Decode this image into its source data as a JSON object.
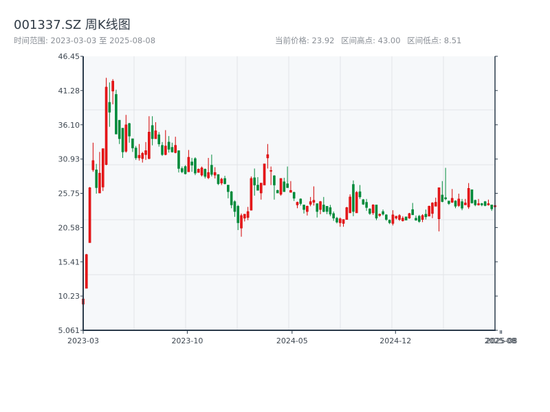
{
  "header": {
    "title": "001337.SZ 周K线图",
    "range_label": "时间范围: 2023-03-03 至 2025-08-08",
    "current_price": "当前价格: 23.92",
    "range_high": "区间高点: 43.00",
    "range_low": "区间低点: 8.51"
  },
  "colors": {
    "up": "#d40000",
    "down": "#008a3a",
    "plot_bg": "#f6f8fa",
    "axis": "#2a3a4a"
  },
  "chart_data": {
    "type": "candlestick",
    "title": "001337.SZ 周K线图",
    "xlabel": "",
    "ylabel": "",
    "ylim": [
      5.061,
      46.45
    ],
    "y_ticks": [
      "46.45",
      "41.28",
      "36.10",
      "30.93",
      "25.75",
      "20.58",
      "15.41",
      "10.23",
      "5.061"
    ],
    "x_ticks": [
      {
        "label": "2023-03",
        "index": 0
      },
      {
        "label": "2023-10",
        "index": 31.6
      },
      {
        "label": "2024-05",
        "index": 63.4
      },
      {
        "label": "2024-12",
        "index": 94.8
      },
      {
        "label": "2025-08",
        "index": 126.6
      },
      {
        "label": "2025-08",
        "index": 127
      }
    ],
    "grid": true,
    "ohlc": [
      [
        9.0,
        10.1,
        8.51,
        9.8
      ],
      [
        11.4,
        16.6,
        11.4,
        16.5
      ],
      [
        18.3,
        26.7,
        18.3,
        26.6
      ],
      [
        29.3,
        33.4,
        29.0,
        30.7
      ],
      [
        29.3,
        30.2,
        25.7,
        26.6
      ],
      [
        25.8,
        32.0,
        25.8,
        28.8
      ],
      [
        26.7,
        32.5,
        26.1,
        32.5
      ],
      [
        30.1,
        43.2,
        30.0,
        41.8
      ],
      [
        39.5,
        42.5,
        35.8,
        38.0
      ],
      [
        41.2,
        43.0,
        39.2,
        42.7
      ],
      [
        40.7,
        41.4,
        34.7,
        34.7
      ],
      [
        36.8,
        36.8,
        33.2,
        34.0
      ],
      [
        35.6,
        35.6,
        31.1,
        32.0
      ],
      [
        32.1,
        37.6,
        31.9,
        36.1
      ],
      [
        36.3,
        36.4,
        33.4,
        34.4
      ],
      [
        34.0,
        34.0,
        32.0,
        32.6
      ],
      [
        32.6,
        32.9,
        30.8,
        31.1
      ],
      [
        31.1,
        33.2,
        30.7,
        31.5
      ],
      [
        31.0,
        32.0,
        30.4,
        31.8
      ],
      [
        31.6,
        33.5,
        30.8,
        32.2
      ],
      [
        31.0,
        37.4,
        30.9,
        35.0
      ],
      [
        36.0,
        37.4,
        33.0,
        34.0
      ],
      [
        34.0,
        36.5,
        34.0,
        35.2
      ],
      [
        34.6,
        35.0,
        32.8,
        33.2
      ],
      [
        33.0,
        33.5,
        31.4,
        31.6
      ],
      [
        31.6,
        35.3,
        31.5,
        32.9
      ],
      [
        33.5,
        34.4,
        31.9,
        32.4
      ],
      [
        32.7,
        33.4,
        31.9,
        32.0
      ],
      [
        31.9,
        34.3,
        31.8,
        33.0
      ],
      [
        32.2,
        32.2,
        28.9,
        29.5
      ],
      [
        29.5,
        29.8,
        28.8,
        29.0
      ],
      [
        29.8,
        30.0,
        28.6,
        28.7
      ],
      [
        29.0,
        32.3,
        29.0,
        31.2
      ],
      [
        30.5,
        31.1,
        29.0,
        30.0
      ],
      [
        31.0,
        31.2,
        28.5,
        28.8
      ],
      [
        28.9,
        29.5,
        28.9,
        29.4
      ],
      [
        28.5,
        29.8,
        28.3,
        29.6
      ],
      [
        29.4,
        29.5,
        28.0,
        28.3
      ],
      [
        28.1,
        31.1,
        27.9,
        28.9
      ],
      [
        30.0,
        31.6,
        28.3,
        28.6
      ],
      [
        28.5,
        29.7,
        28.0,
        28.9
      ],
      [
        28.6,
        28.6,
        27.0,
        27.2
      ],
      [
        27.3,
        28.1,
        27.0,
        27.9
      ],
      [
        28.0,
        28.4,
        27.1,
        27.2
      ],
      [
        27.0,
        27.0,
        25.0,
        26.0
      ],
      [
        26.0,
        26.1,
        23.5,
        24.0
      ],
      [
        24.5,
        24.7,
        22.2,
        23.0
      ],
      [
        23.8,
        24.0,
        20.2,
        21.3
      ],
      [
        20.5,
        22.7,
        19.2,
        22.4
      ],
      [
        22.0,
        22.6,
        21.5,
        22.6
      ],
      [
        22.1,
        23.7,
        21.7,
        23.0
      ],
      [
        23.2,
        28.3,
        23.2,
        28.0
      ],
      [
        28.1,
        29.5,
        25.4,
        27.0
      ],
      [
        27.0,
        28.2,
        26.2,
        26.2
      ],
      [
        25.8,
        27.3,
        24.8,
        27.3
      ],
      [
        27.0,
        30.2,
        27.0,
        30.2
      ],
      [
        31.1,
        33.2,
        29.5,
        31.6
      ],
      [
        29.1,
        29.8,
        27.0,
        29.2
      ],
      [
        28.4,
        28.5,
        24.8,
        27.0
      ],
      [
        26.2,
        26.3,
        25.8,
        25.8
      ],
      [
        25.6,
        28.0,
        25.4,
        28.0
      ],
      [
        27.5,
        28.1,
        26.0,
        26.0
      ],
      [
        27.2,
        29.8,
        26.6,
        26.6
      ],
      [
        25.9,
        27.6,
        25.9,
        26.2
      ],
      [
        25.9,
        26.0,
        24.6,
        25.0
      ],
      [
        24.0,
        24.5,
        23.5,
        24.4
      ],
      [
        24.9,
        25.0,
        23.9,
        24.2
      ],
      [
        24.0,
        24.0,
        22.7,
        23.3
      ],
      [
        23.0,
        23.9,
        22.4,
        23.8
      ],
      [
        24.1,
        25.2,
        23.8,
        24.5
      ],
      [
        24.4,
        26.8,
        23.9,
        24.7
      ],
      [
        24.2,
        24.2,
        22.1,
        23.0
      ],
      [
        23.3,
        24.6,
        22.6,
        24.5
      ],
      [
        24.0,
        25.2,
        22.9,
        23.0
      ],
      [
        23.8,
        23.8,
        22.6,
        23.0
      ],
      [
        23.6,
        24.0,
        22.3,
        22.6
      ],
      [
        22.7,
        23.0,
        21.6,
        22.0
      ],
      [
        22.0,
        22.2,
        21.2,
        21.4
      ],
      [
        21.3,
        22.1,
        20.7,
        21.9
      ],
      [
        21.2,
        21.8,
        20.7,
        21.8
      ],
      [
        21.8,
        23.7,
        21.8,
        23.6
      ],
      [
        22.8,
        25.6,
        22.8,
        25.2
      ],
      [
        27.1,
        27.7,
        22.3,
        23.0
      ],
      [
        22.8,
        26.1,
        22.8,
        25.9
      ],
      [
        26.0,
        27.0,
        24.9,
        25.2
      ],
      [
        24.8,
        24.9,
        24.0,
        24.1
      ],
      [
        24.4,
        24.9,
        23.1,
        23.6
      ],
      [
        23.4,
        23.5,
        22.5,
        22.7
      ],
      [
        22.8,
        24.1,
        22.5,
        24.0
      ],
      [
        24.0,
        24.0,
        21.7,
        22.0
      ],
      [
        22.4,
        22.7,
        22.2,
        22.6
      ],
      [
        23.0,
        23.3,
        22.4,
        22.6
      ],
      [
        22.5,
        22.6,
        21.6,
        21.8
      ],
      [
        21.7,
        21.8,
        21.1,
        21.3
      ],
      [
        21.2,
        23.2,
        20.9,
        22.5
      ],
      [
        22.0,
        22.3,
        21.8,
        22.3
      ],
      [
        21.8,
        22.6,
        21.6,
        22.4
      ],
      [
        21.6,
        22.3,
        21.5,
        22.0
      ],
      [
        22.2,
        22.2,
        21.7,
        21.7
      ],
      [
        22.0,
        22.8,
        21.9,
        22.7
      ],
      [
        23.3,
        24.3,
        22.5,
        22.5
      ],
      [
        22.0,
        22.4,
        21.6,
        21.7
      ],
      [
        22.3,
        22.5,
        21.3,
        21.5
      ],
      [
        21.8,
        22.6,
        21.4,
        22.4
      ],
      [
        22.6,
        23.3,
        21.8,
        22.2
      ],
      [
        22.3,
        23.9,
        22.3,
        23.8
      ],
      [
        22.7,
        24.4,
        22.0,
        24.3
      ],
      [
        23.8,
        25.1,
        23.8,
        24.4
      ],
      [
        21.9,
        26.6,
        20.0,
        26.6
      ],
      [
        25.5,
        27.6,
        24.4,
        24.5
      ],
      [
        25.1,
        29.6,
        24.7,
        24.9
      ],
      [
        24.6,
        24.6,
        24.0,
        24.2
      ],
      [
        24.4,
        26.4,
        24.3,
        25.0
      ],
      [
        24.6,
        24.7,
        23.5,
        23.8
      ],
      [
        23.9,
        25.7,
        23.7,
        24.9
      ],
      [
        24.5,
        24.9,
        23.2,
        23.5
      ],
      [
        24.0,
        24.9,
        24.0,
        24.3
      ],
      [
        23.7,
        27.3,
        23.4,
        26.5
      ],
      [
        26.3,
        26.3,
        24.2,
        24.3
      ],
      [
        24.7,
        24.8,
        23.8,
        24.0
      ],
      [
        24.0,
        24.9,
        23.9,
        24.2
      ],
      [
        24.2,
        24.3,
        23.8,
        24.0
      ],
      [
        24.5,
        24.6,
        23.8,
        23.9
      ],
      [
        24.0,
        24.8,
        23.9,
        24.2
      ],
      [
        24.0,
        24.0,
        23.1,
        23.4
      ],
      [
        23.7,
        24.4,
        23.6,
        23.92
      ]
    ]
  }
}
